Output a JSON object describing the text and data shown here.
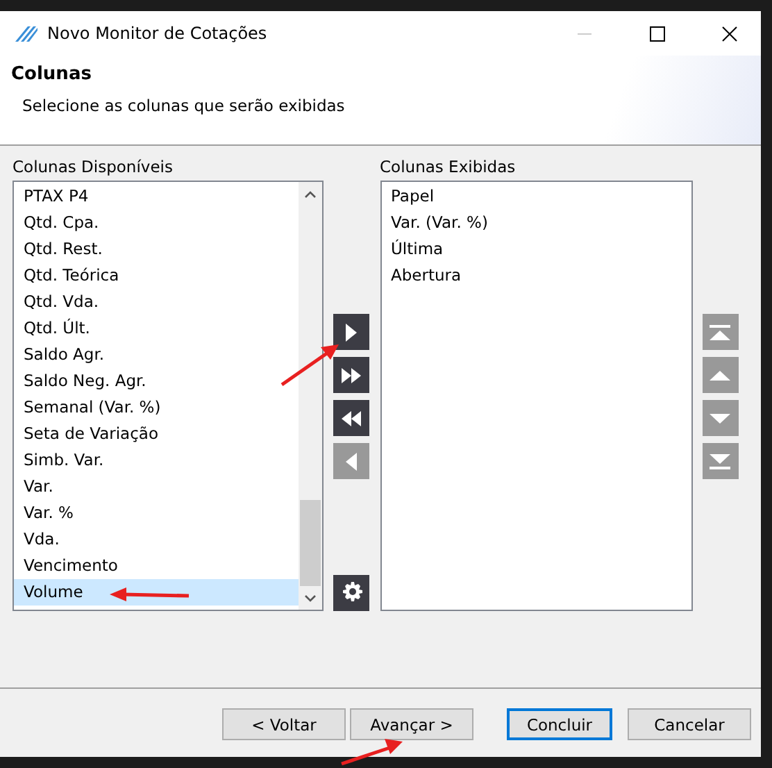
{
  "window": {
    "title": "Novo Monitor de Cotações"
  },
  "header": {
    "title": "Colunas",
    "subtitle": "Selecione as colunas que serão exibidas"
  },
  "available": {
    "label": "Colunas Disponíveis",
    "items": [
      {
        "text": "PTAX P4",
        "selected": false
      },
      {
        "text": "Qtd. Cpa.",
        "selected": false
      },
      {
        "text": "Qtd. Rest.",
        "selected": false
      },
      {
        "text": "Qtd. Teórica",
        "selected": false
      },
      {
        "text": "Qtd. Vda.",
        "selected": false
      },
      {
        "text": "Qtd. Últ.",
        "selected": false
      },
      {
        "text": "Saldo Agr.",
        "selected": false
      },
      {
        "text": "Saldo Neg. Agr.",
        "selected": false
      },
      {
        "text": "Semanal (Var. %)",
        "selected": false
      },
      {
        "text": "Seta de Variação",
        "selected": false
      },
      {
        "text": "Simb. Var.",
        "selected": false
      },
      {
        "text": "Var.",
        "selected": false
      },
      {
        "text": "Var. %",
        "selected": false
      },
      {
        "text": "Vda.",
        "selected": false
      },
      {
        "text": "Vencimento",
        "selected": false
      },
      {
        "text": "Volume",
        "selected": true
      }
    ]
  },
  "transfer_buttons": [
    {
      "kind": "add",
      "disabled": false
    },
    {
      "kind": "add-all",
      "disabled": false
    },
    {
      "kind": "remove-all",
      "disabled": false
    },
    {
      "kind": "remove",
      "disabled": true
    }
  ],
  "displayed": {
    "label": "Colunas Exibidas",
    "items": [
      {
        "text": "Papel",
        "selected": false
      },
      {
        "text": "Var. (Var. %)",
        "selected": false
      },
      {
        "text": "Última",
        "selected": false
      },
      {
        "text": "Abertura",
        "selected": false
      }
    ]
  },
  "order_buttons": [
    {
      "kind": "top",
      "disabled": true
    },
    {
      "kind": "up",
      "disabled": true
    },
    {
      "kind": "down",
      "disabled": true
    },
    {
      "kind": "bottom",
      "disabled": true
    }
  ],
  "footer_buttons": [
    {
      "label": "< Voltar",
      "selected": false
    },
    {
      "label": "Avançar >",
      "selected": false
    },
    {
      "label": "Concluir",
      "selected": true
    },
    {
      "label": "Cancelar",
      "selected": false
    }
  ]
}
